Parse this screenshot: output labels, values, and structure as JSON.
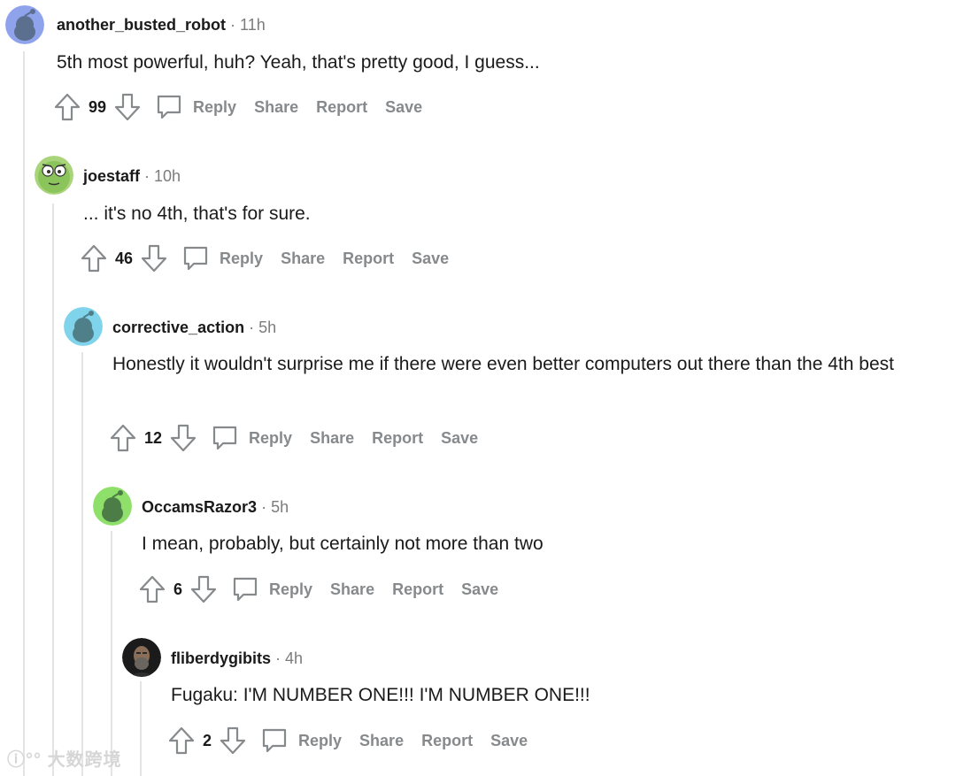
{
  "colors": {
    "meta_gray": "#7c7c7c",
    "action_gray": "#878a8c",
    "line": "#e4e4e5"
  },
  "comments": [
    {
      "username": "another_busted_robot",
      "time": "11h",
      "avatar": "snoo-blue-avatar",
      "text": "5th most powerful, huh? Yeah, that's pretty good, I guess...",
      "score": "99",
      "actions": {
        "reply": "Reply",
        "share": "Share",
        "report": "Report",
        "save": "Save"
      }
    },
    {
      "username": "joestaff",
      "time": "10h",
      "avatar": "green-face-avatar",
      "text": "... it's no 4th, that's for sure.",
      "score": "46",
      "actions": {
        "reply": "Reply",
        "share": "Share",
        "report": "Report",
        "save": "Save"
      }
    },
    {
      "username": "corrective_action",
      "time": "5h",
      "avatar": "snoo-cyan-avatar",
      "text": "Honestly it wouldn't surprise me if there were even better computers out there than the 4th best",
      "score": "12",
      "actions": {
        "reply": "Reply",
        "share": "Share",
        "report": "Report",
        "save": "Save"
      }
    },
    {
      "username": "OccamsRazor3",
      "time": "5h",
      "avatar": "snoo-green-avatar",
      "text": "I mean, probably, but certainly not more than two",
      "score": "6",
      "actions": {
        "reply": "Reply",
        "share": "Share",
        "report": "Report",
        "save": "Save"
      }
    },
    {
      "username": "fliberdygibits",
      "time": "4h",
      "avatar": "photo-avatar",
      "text": "Fugaku: I'M NUMBER ONE!!! I'M NUMBER ONE!!!",
      "score": "2",
      "actions": {
        "reply": "Reply",
        "share": "Share",
        "report": "Report",
        "save": "Save"
      }
    }
  ],
  "watermark": "大数跨境"
}
